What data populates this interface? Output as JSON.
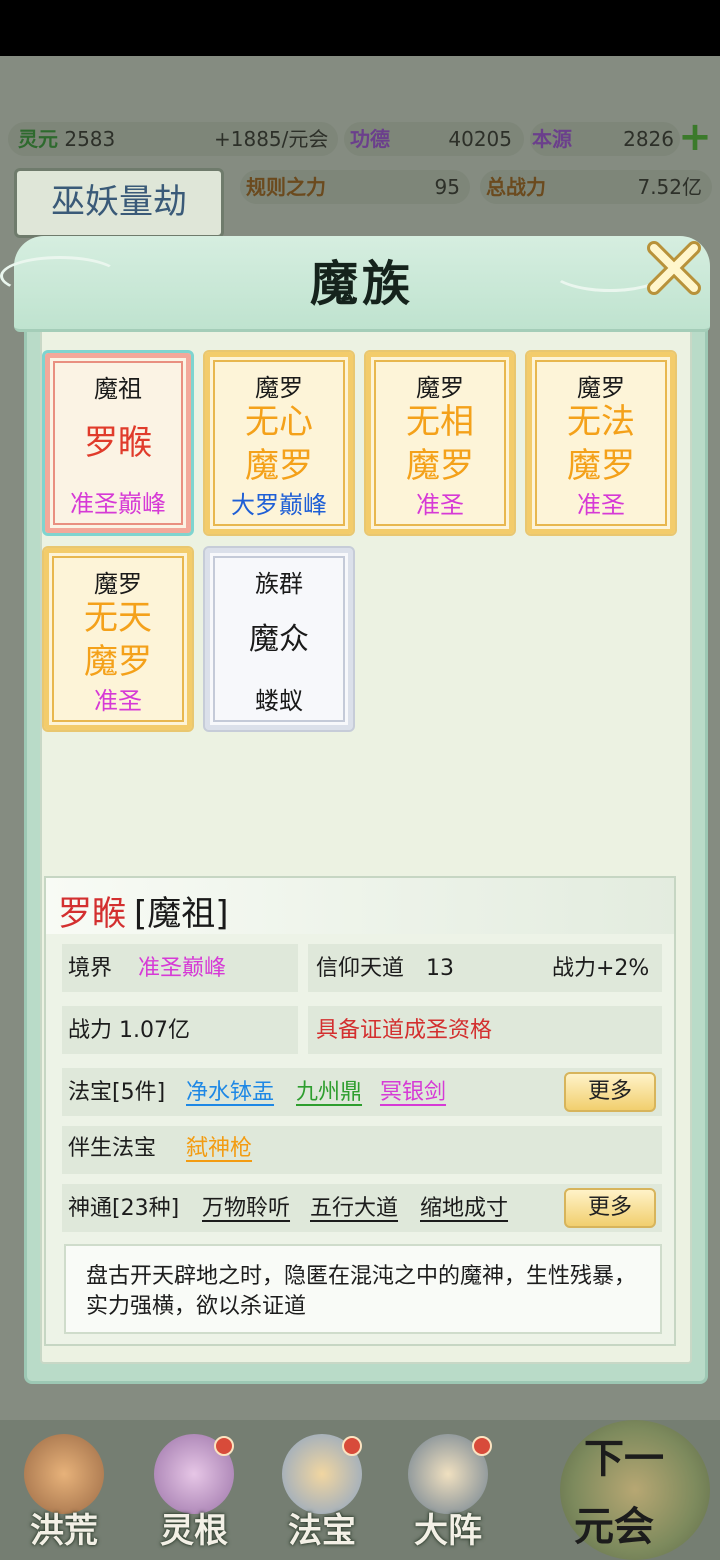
{
  "top_resources": {
    "lingyuan": {
      "label": "灵元",
      "value": "2583",
      "rate": "+1885/元会"
    },
    "gongde": {
      "label": "功德",
      "value": "40205"
    },
    "benyuan": {
      "label": "本源",
      "value": "2826"
    },
    "guize": {
      "label": "规则之力",
      "value": "95"
    },
    "zong": {
      "label": "总战力",
      "value": "7.52亿"
    }
  },
  "era_title": "巫妖量劫",
  "modal": {
    "title": "魔族",
    "cards": [
      {
        "type": "魔祖",
        "name_lines": [
          "罗睺"
        ],
        "rank": "准圣巅峰",
        "style": "red",
        "name_color": "#e03b2b",
        "rank_color": "#d63ad6",
        "selected": true
      },
      {
        "type": "魔罗",
        "name_lines": [
          "无心",
          "魔罗"
        ],
        "rank": "大罗巅峰",
        "style": "gold",
        "name_color": "#f4a11a",
        "rank_color": "#1f5fd6"
      },
      {
        "type": "魔罗",
        "name_lines": [
          "无相",
          "魔罗"
        ],
        "rank": "准圣",
        "style": "gold",
        "name_color": "#f4a11a",
        "rank_color": "#d63ad6"
      },
      {
        "type": "魔罗",
        "name_lines": [
          "无法",
          "魔罗"
        ],
        "rank": "准圣",
        "style": "gold",
        "name_color": "#f4a11a",
        "rank_color": "#d63ad6"
      },
      {
        "type": "魔罗",
        "name_lines": [
          "无天",
          "魔罗"
        ],
        "rank": "准圣",
        "style": "gold",
        "name_color": "#f4a11a",
        "rank_color": "#d63ad6"
      },
      {
        "type": "族群",
        "name_lines": [
          "魔众"
        ],
        "rank": "蝼蚁",
        "style": "silver",
        "name_color": "#1a1a1a",
        "rank_color": "#1a1a1a"
      }
    ]
  },
  "details": {
    "name": "罗睺",
    "title": "[魔祖]",
    "realm_label": "境界",
    "realm_value": "准圣巅峰",
    "faith_label": "信仰天道",
    "faith_value": "13",
    "power_bonus": "战力+2%",
    "power": "战力 1.07亿",
    "qualification": "具备证道成圣资格",
    "treasure_label": "法宝[5件]",
    "treasures": [
      "净水钵盂",
      "九州鼎",
      "冥银剑"
    ],
    "companion_label": "伴生法宝",
    "companion": "弑神枪",
    "skills_label": "神通[23种]",
    "skills": [
      "万物聆听",
      "五行大道",
      "缩地成寸"
    ],
    "more_label": "更多",
    "description": "盘古开天辟地之时，隐匿在混沌之中的魔神，生性残暴，实力强横，欲以杀证道"
  },
  "nav": [
    {
      "label": "洪荒"
    },
    {
      "label": "灵根"
    },
    {
      "label": "法宝"
    },
    {
      "label": "大阵"
    }
  ],
  "next_era": {
    "line1": "下一",
    "line2": "元会"
  },
  "colors": {
    "accent_red": "#d32f2f",
    "link_blue": "#1e88e5",
    "link_green": "#2e9e2e",
    "link_pink": "#d63ad6",
    "link_orange": "#f39c12"
  }
}
